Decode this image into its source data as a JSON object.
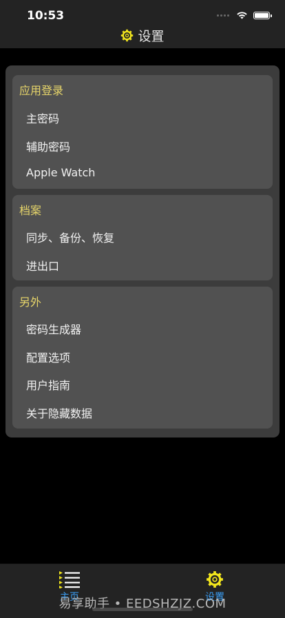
{
  "status_bar": {
    "time": "10:53"
  },
  "header": {
    "title": "设置"
  },
  "sections": [
    {
      "title": "应用登录",
      "items": [
        "主密码",
        "辅助密码",
        "Apple Watch"
      ]
    },
    {
      "title": "档案",
      "items": [
        "同步、备份、恢复",
        "进出口"
      ]
    },
    {
      "title": "另外",
      "items": [
        "密码生成器",
        "配置选项",
        "用户指南",
        "关于隐藏数据"
      ]
    }
  ],
  "tabbar": {
    "home_label": "主页",
    "settings_label": "设置",
    "active_color": "#3a9ef5",
    "icon_color": "#f2e61d"
  },
  "watermark": "易享助手 • EEDSHZJZ.COM"
}
